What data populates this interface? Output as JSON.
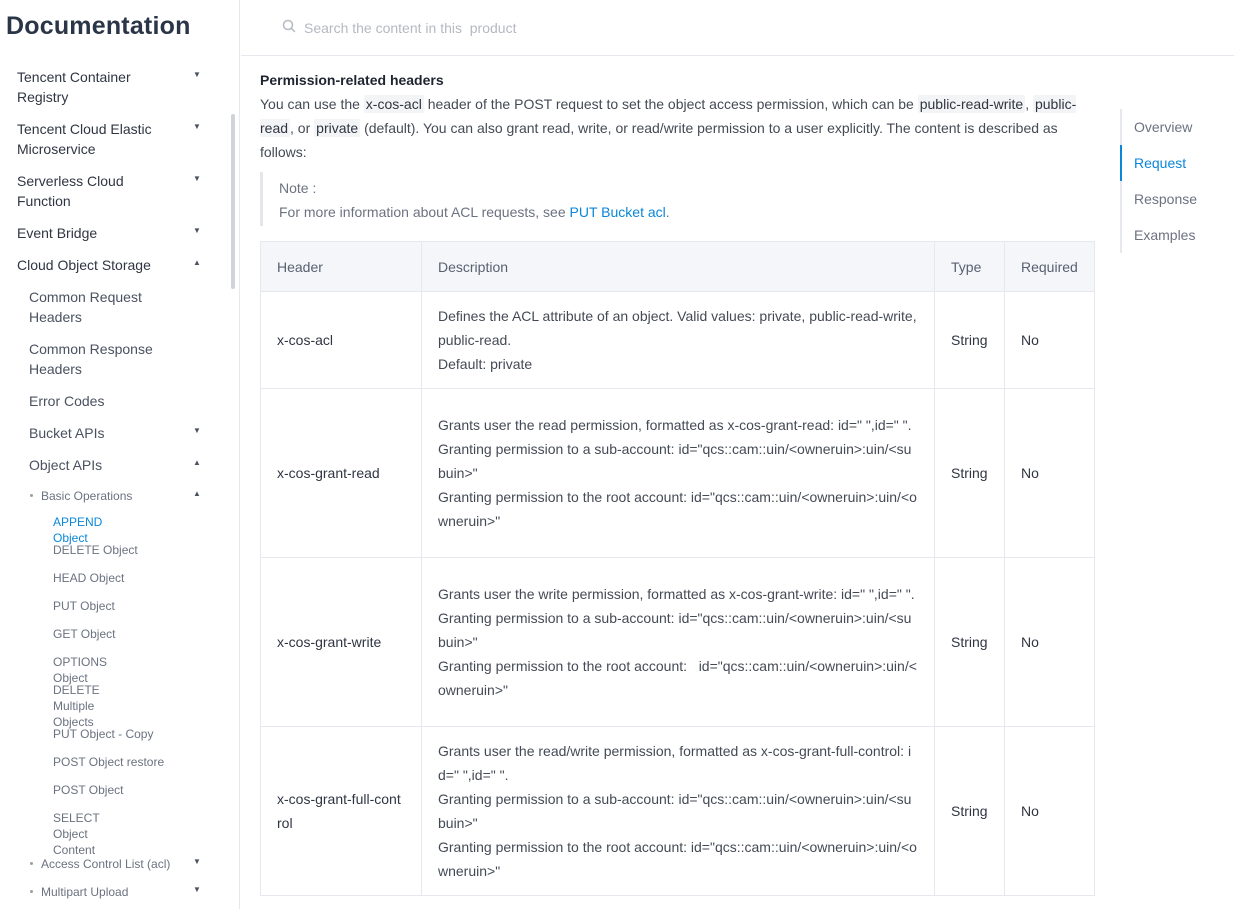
{
  "sidebar": {
    "title": "Documentation",
    "items": [
      {
        "label": "Tencent Container Registry",
        "caret": "▼"
      },
      {
        "label": "Tencent Cloud Elastic Microservice",
        "caret": "▼"
      },
      {
        "label": "Serverless Cloud Function",
        "caret": "▼"
      },
      {
        "label": "Event Bridge",
        "caret": "▼"
      },
      {
        "label": "Cloud Object Storage",
        "caret": "▲"
      },
      {
        "label": "Common Request Headers"
      },
      {
        "label": "Common Response Headers"
      },
      {
        "label": "Error Codes"
      },
      {
        "label": "Bucket APIs",
        "caret": "▼"
      },
      {
        "label": "Object APIs",
        "caret": "▲"
      },
      {
        "label": "Basic Operations",
        "caret": "▲"
      },
      {
        "label": "APPEND Object"
      },
      {
        "label": "DELETE Object"
      },
      {
        "label": "HEAD Object"
      },
      {
        "label": "PUT Object"
      },
      {
        "label": "GET Object"
      },
      {
        "label": "OPTIONS Object"
      },
      {
        "label": "DELETE Multiple Objects"
      },
      {
        "label": "PUT Object - Copy"
      },
      {
        "label": "POST Object restore"
      },
      {
        "label": "POST Object"
      },
      {
        "label": "SELECT Object Content"
      },
      {
        "label": "Access Control List (acl)",
        "caret": "▼"
      },
      {
        "label": "Multipart Upload",
        "caret": "▼"
      }
    ]
  },
  "search": {
    "placeholder": "Search the content in this  product"
  },
  "content": {
    "title": "Permission-related headers",
    "para": {
      "t1": "You can use the ",
      "c1": "x-cos-acl",
      "t2": " header of the POST request to set the object access permission, which can be ",
      "c2": "public-read-write",
      "t3": ", ",
      "c3": "public-read",
      "t4": ", or ",
      "c4": "private",
      "t5": " (default). You can also grant read, write, or read/write permission to a user explicitly. The content is described as follows:"
    },
    "note": {
      "title": "Note :",
      "text": "For more information about ACL requests, see ",
      "link": "PUT Bucket acl",
      "end": "."
    }
  },
  "table": {
    "headers": [
      "Header",
      "Description",
      "Type",
      "Required"
    ],
    "rows": [
      {
        "header": "x-cos-acl",
        "d1": "Defines the ACL attribute of an object. Valid values: private, public-read-write, public-read.",
        "d2": "Default: private",
        "d3": "",
        "type": "String",
        "required": "No"
      },
      {
        "header": "x-cos-grant-read",
        "d1": "Grants user the read permission, formatted as x-cos-grant-read: id=\" \",id=\" \".",
        "d2": "Granting permission to a sub-account: id=\"qcs::cam::uin/<owneruin>:uin/<subuin>\"",
        "d3": "Granting permission to the root account: id=\"qcs::cam::uin/<owneruin>:uin/<owneruin>\"",
        "type": "String",
        "required": "No"
      },
      {
        "header": "x-cos-grant-write",
        "d1": "Grants user the write permission, formatted as x-cos-grant-write: id=\" \",id=\" \".",
        "d2": "Granting permission to a sub-account: id=\"qcs::cam::uin/<owneruin>:uin/<subuin>\"",
        "d3": "Granting permission to the root account:   id=\"qcs::cam::uin/<owneruin>:uin/<owneruin>\"",
        "type": "String",
        "required": "No"
      },
      {
        "header": "x-cos-grant-full-control",
        "d1": "Grants user the read/write permission, formatted as x-cos-grant-full-control: id=\" \",id=\" \".",
        "d2": "Granting permission to a sub-account: id=\"qcs::cam::uin/<owneruin>:uin/<subuin>\"",
        "d3": "Granting permission to the root account: id=\"qcs::cam::uin/<owneruin>:uin/<owneruin>\"",
        "type": "String",
        "required": "No"
      }
    ]
  },
  "toc": {
    "items": [
      {
        "label": "Overview"
      },
      {
        "label": "Request"
      },
      {
        "label": "Response"
      },
      {
        "label": "Examples"
      }
    ]
  },
  "colors": {
    "accent": "#0a87d8",
    "title": "#2a3547",
    "border": "#e5e8ed"
  }
}
